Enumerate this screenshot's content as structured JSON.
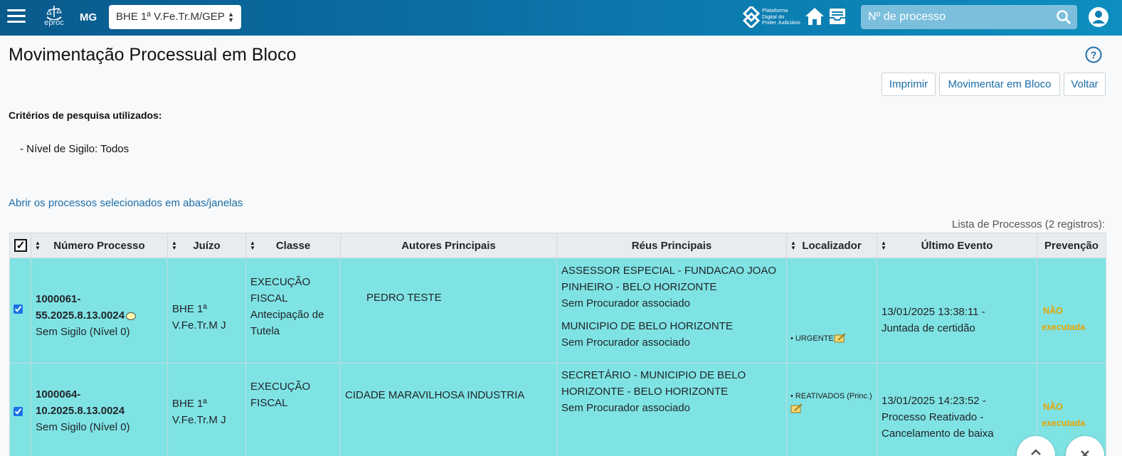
{
  "header": {
    "uf": "MG",
    "org_select": "BHE 1ª V.Fe.Tr.M/GEP",
    "logo_text": "eproc",
    "pdpj_text": [
      "Plataforma",
      "Digital do",
      "Poder Judiciário"
    ],
    "search_placeholder": "Nº de processo"
  },
  "page": {
    "title": "Movimentação Processual em Bloco",
    "buttons": {
      "print": "Imprimir",
      "move": "Movimentar em Bloco",
      "back": "Voltar"
    },
    "criteria_heading": "Critérios de pesquisa utilizados:",
    "criteria_item": "- Nível de Sigilo: Todos",
    "open_link": "Abrir os processos selecionados em abas/janelas",
    "list_caption": "Lista de Processos (2 registros):"
  },
  "table": {
    "columns": [
      "Número Processo",
      "Juízo",
      "Classe",
      "Autores Principais",
      "Réus Principais",
      "Localizador",
      "Último Evento",
      "Prevenção"
    ],
    "rows": [
      {
        "numero_a": "1000061-",
        "numero_b": "55.2025.8.13.0024",
        "sigilo": "Sem Sigilo (Nível 0)",
        "juizo_a": "BHE 1ª",
        "juizo_b": "V.Fe.Tr.M J",
        "classe": [
          "EXECUÇÃO",
          "FISCAL",
          "Antecipação de",
          "Tutela"
        ],
        "autor": "PEDRO TESTE",
        "reus": [
          "ASSESSOR ESPECIAL - FUNDACAO JOAO",
          "PINHEIRO - BELO HORIZONTE",
          "Sem Procurador associado",
          "MUNICIPIO DE BELO HORIZONTE",
          "Sem Procurador associado"
        ],
        "localizador": "• URGENTE",
        "evento": [
          "13/01/2025 13:38:11 -",
          "Juntada de certidão"
        ],
        "prevencao": [
          "NÃO",
          "executada"
        ]
      },
      {
        "numero_a": "1000064-",
        "numero_b": "10.2025.8.13.0024",
        "sigilo": "Sem Sigilo (Nível 0)",
        "juizo_a": "BHE 1ª",
        "juizo_b": "V.Fe.Tr.M J",
        "classe": [
          "EXECUÇÃO",
          "FISCAL"
        ],
        "autor": "CIDADE MARAVILHOSA INDUSTRIA",
        "reus": [
          "SECRETÁRIO - MUNICIPIO DE BELO",
          "HORIZONTE - BELO HORIZONTE",
          "Sem Procurador associado"
        ],
        "localizador": "• REATIVADOS (Princ.)",
        "evento": [
          "13/01/2025 14:23:52 -",
          "Processo Reativado -",
          "Cancelamento de baixa"
        ],
        "prevencao": [
          "NÃO",
          "executada"
        ]
      }
    ]
  }
}
